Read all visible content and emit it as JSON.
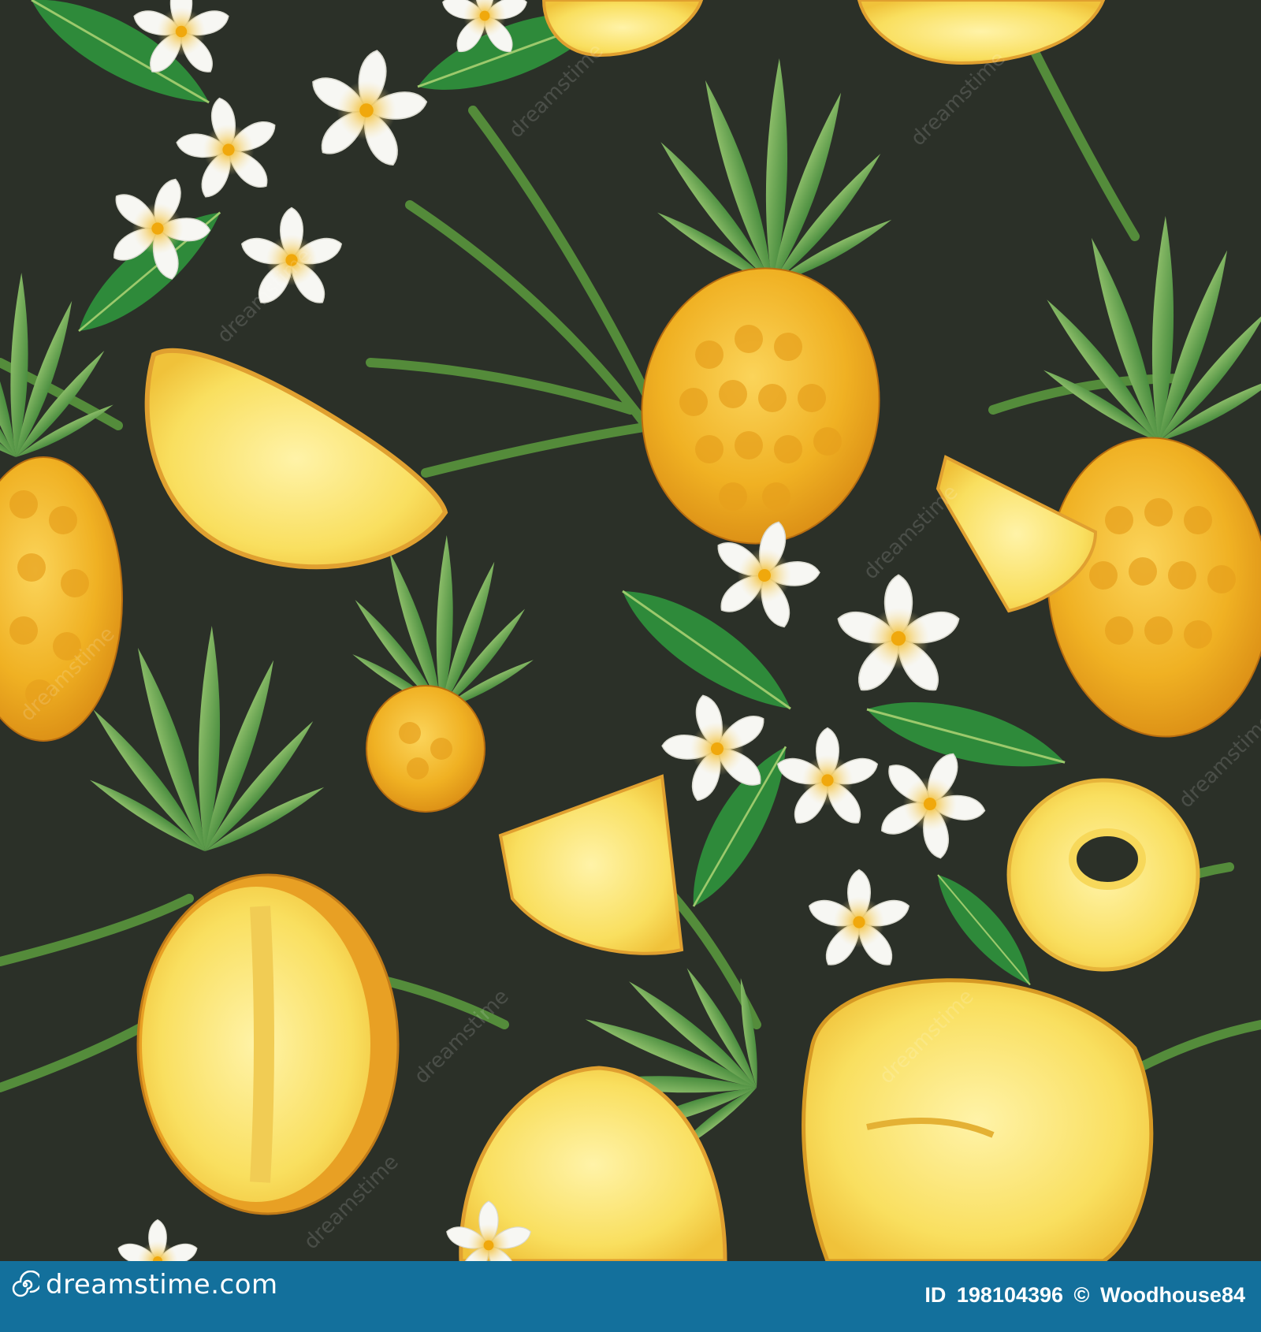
{
  "image": {
    "subject": "seamless tropical pattern of pineapples, pineapple slices and white plumeria flowers with green leaves",
    "background_color": "#2b3028",
    "accent_colors": {
      "pineapple": "#f2b51e",
      "flesh": "#f8de5a",
      "leaf": "#3f8a34",
      "flower": "#f6f6f2",
      "flower_center": "#f4c21b"
    }
  },
  "watermark": {
    "text": "dreamstime"
  },
  "footer": {
    "brand": "dreamstime.com",
    "id_label": "ID",
    "id_value": "198104396",
    "copyright_symbol": "©",
    "author": "Woodhouse84",
    "bar_color": "#13709c"
  }
}
